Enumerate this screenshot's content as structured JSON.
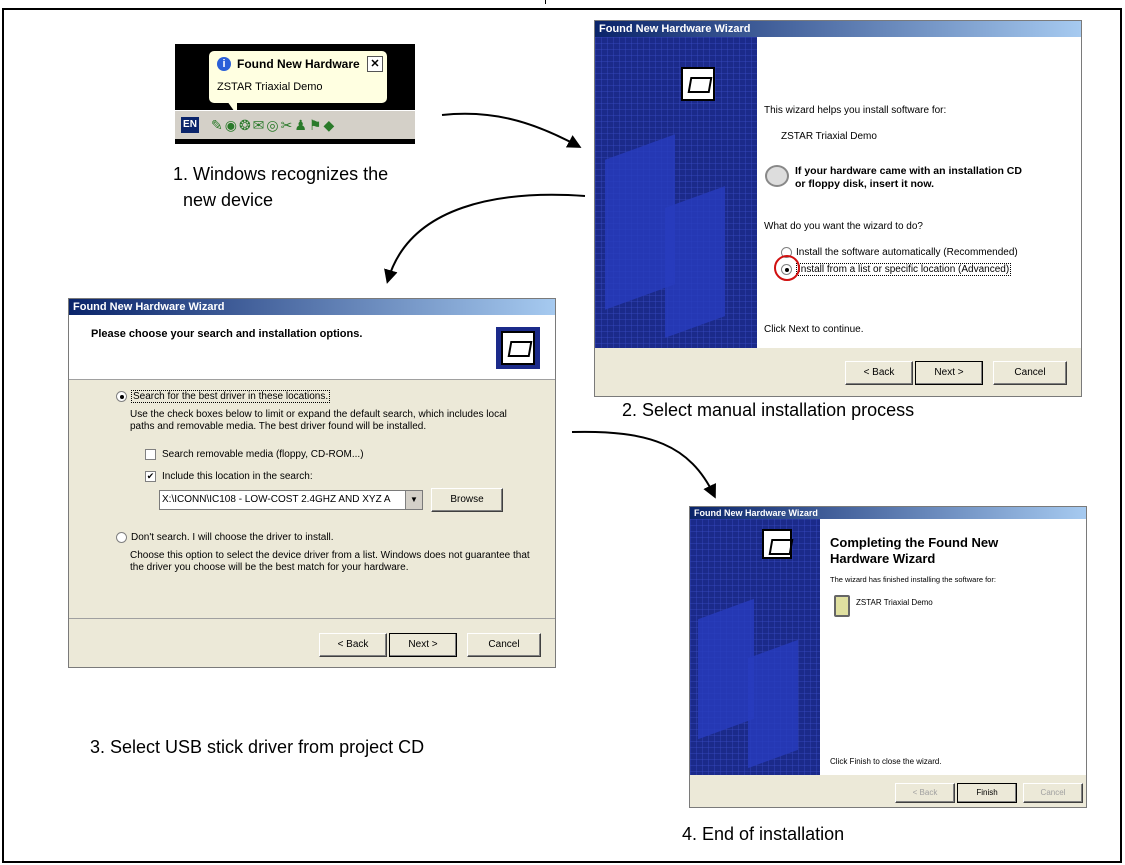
{
  "step1": {
    "balloon_title": "Found New Hardware",
    "balloon_text": "ZSTAR Triaxial Demo",
    "lang": "EN",
    "caption_line1": "1. Windows recognizes the",
    "caption_line2": "new device"
  },
  "step2": {
    "title": "Found New Hardware Wizard",
    "intro": "This wizard helps you install software for:",
    "device": "ZSTAR Triaxial Demo",
    "cd_line1": "If your hardware came with an installation CD",
    "cd_line2": "or floppy disk, insert it now.",
    "question": "What do you want the wizard to do?",
    "option_auto": "Install the software automatically (Recommended)",
    "option_manual": "Install from a list or specific location (Advanced)",
    "continue": "Click Next to continue.",
    "back": "< Back",
    "next": "Next >",
    "cancel": "Cancel",
    "caption": "2. Select manual installation process"
  },
  "step3": {
    "title": "Found New Hardware Wizard",
    "heading": "Please choose your search and installation options.",
    "option_search": "Search for the best driver in these locations.",
    "search_desc1": "Use the check boxes below to limit or expand the default search, which includes local",
    "search_desc2": "paths and removable media. The best driver found will be installed.",
    "check_removable": "Search removable media (floppy, CD-ROM...)",
    "check_include": "Include this location in the search:",
    "path_value": "X:\\ICONN\\IC108 - LOW-COST 2.4GHZ AND XYZ A",
    "browse": "Browse",
    "option_dont": "Don't search. I will choose the driver to install.",
    "dont_desc1": "Choose this option to select the device driver from a list.  Windows does not guarantee that",
    "dont_desc2": "the driver you choose will be the best match for your hardware.",
    "back": "< Back",
    "next": "Next >",
    "cancel": "Cancel",
    "caption": "3. Select USB stick driver from project CD"
  },
  "step4": {
    "title": "Found New Hardware Wizard",
    "heading1": "Completing the Found New",
    "heading2": "Hardware Wizard",
    "finished": "The wizard has finished installing the software for:",
    "device": "ZSTAR Triaxial Demo",
    "close_hint": "Click Finish to close the wizard.",
    "back": "< Back",
    "finish": "Finish",
    "cancel": "Cancel",
    "caption": "4. End of installation"
  }
}
